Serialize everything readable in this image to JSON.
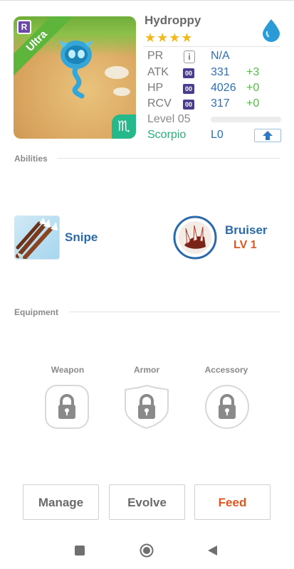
{
  "monster": {
    "name": "Hydroppy",
    "rarity_ribbon": "Ultra",
    "rank_badge": "R",
    "star_count": 4,
    "stars": "★★★★",
    "element_icon": "water-drop-icon",
    "zodiac_symbol": "♏"
  },
  "stats": [
    {
      "label": "PR",
      "chip": "i",
      "value": "N/A",
      "bonus": ""
    },
    {
      "label": "ATK",
      "chip": "00",
      "value": "331",
      "bonus": "+3"
    },
    {
      "label": "HP",
      "chip": "00",
      "value": "4026",
      "bonus": "+0"
    },
    {
      "label": "RCV",
      "chip": "00",
      "value": "317",
      "bonus": "+0"
    }
  ],
  "level": {
    "label": "Level 05",
    "progress": 0.0
  },
  "zodiac": {
    "name": "Scorpio",
    "level": "L0",
    "upgrade_icon": "arrow-up-icon"
  },
  "abilities": {
    "title": "Abilities",
    "ability": {
      "name": "Snipe",
      "icon": "arrows-icon"
    },
    "trait": {
      "name": "Bruiser",
      "level": "LV 1",
      "icon": "claw-icon"
    }
  },
  "equipment": {
    "title": "Equipment",
    "slots": [
      {
        "label": "Weapon",
        "icon": "lock-icon"
      },
      {
        "label": "Armor",
        "icon": "lock-icon"
      },
      {
        "label": "Accessory",
        "icon": "lock-icon"
      }
    ]
  },
  "actions": {
    "manage": "Manage",
    "evolve": "Evolve",
    "feed": "Feed"
  },
  "navbar": {
    "back": "back-icon",
    "home": "home-icon",
    "recents": "recents-icon"
  },
  "colors": {
    "accent_blue": "#2e6fb5",
    "bonus_green": "#58b94a",
    "zodiac_green": "#21b07c",
    "feed_orange": "#e0561c",
    "star_gold": "#f4b81c"
  }
}
